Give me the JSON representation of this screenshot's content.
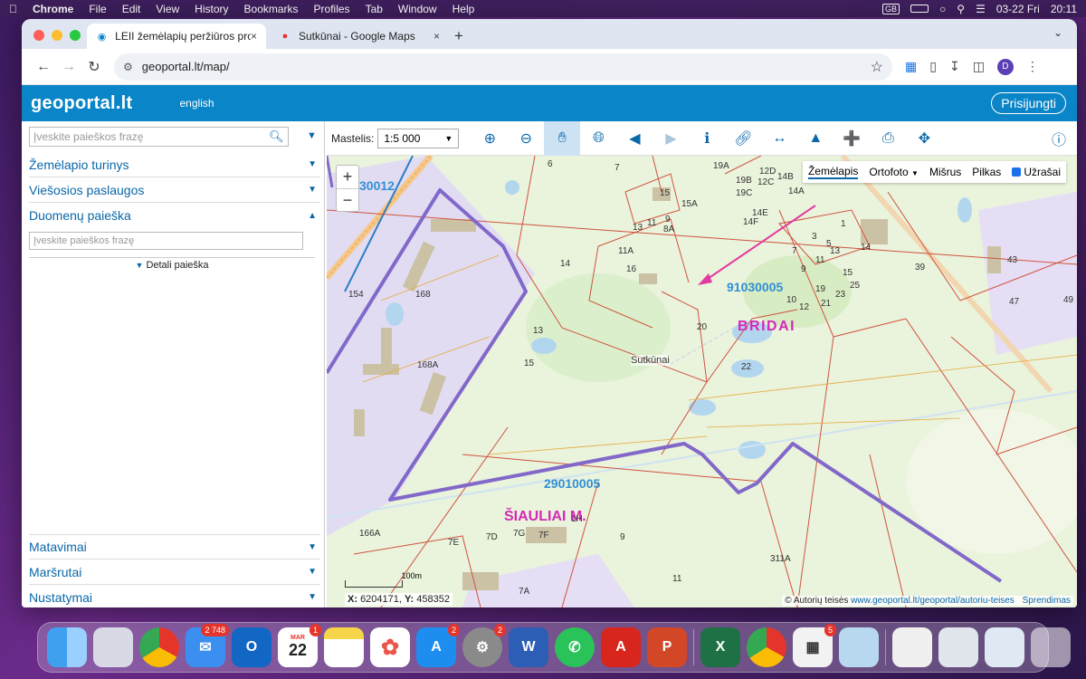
{
  "menubar": {
    "app": "Chrome",
    "items": [
      "File",
      "Edit",
      "View",
      "History",
      "Bookmarks",
      "Profiles",
      "Tab",
      "Window",
      "Help"
    ],
    "date": "03-22 Fri",
    "time": "20:11",
    "input_badge": "GB"
  },
  "browser": {
    "tabs": [
      {
        "title": "LEII žemėlapių peržiūros prog",
        "close": "×"
      },
      {
        "title": "Sutkūnai - Google Maps",
        "close": "×"
      }
    ],
    "new_tab": "+",
    "url": "geoportal.lt/map/",
    "profile_initial": "D"
  },
  "geoportal": {
    "logo": "geoportal.lt",
    "language": "english",
    "login": "Prisijungti"
  },
  "sidebar": {
    "search_placeholder": "Įveskite paieškos frazę",
    "sections": [
      {
        "label": "Žemėlapio turinys"
      },
      {
        "label": "Viešosios paslaugos"
      },
      {
        "label": "Duomenų paieška"
      }
    ],
    "data_search_placeholder": "Įveskite paieškos frazę",
    "detail_search": "Detali paieška",
    "bottom_sections": [
      {
        "label": "Matavimai"
      },
      {
        "label": "Maršrutai"
      },
      {
        "label": "Nustatymai"
      }
    ]
  },
  "map_toolbar": {
    "scale_label": "Mastelis:",
    "scale_value": "1:5 000"
  },
  "layers": {
    "items": [
      "Žemėlapis",
      "Ortofoto",
      "Mišrus",
      "Pilkas"
    ],
    "selected": "Žemėlapis",
    "labels_toggle": "Užrašai"
  },
  "map": {
    "zoom_in": "+",
    "zoom_out": "−",
    "region_codes": [
      "30012",
      "91030005",
      "29010005"
    ],
    "place_names": [
      "BRIDAI",
      "ŠIAULIAI M.",
      "Sutkūnai"
    ],
    "parcels": [
      "6",
      "7",
      "19A",
      "15",
      "15A",
      "11",
      "9",
      "13",
      "8A",
      "11A",
      "16",
      "14",
      "168",
      "168A",
      "154",
      "13",
      "15",
      "20",
      "22",
      "1",
      "3",
      "5",
      "7",
      "13",
      "14",
      "9",
      "11",
      "15",
      "19",
      "23",
      "25",
      "21",
      "10",
      "12",
      "39",
      "43",
      "47",
      "49",
      "166A",
      "7E",
      "7D",
      "7G",
      "7F",
      "9",
      "11",
      "7A",
      "311A",
      "12D",
      "12C",
      "14B",
      "14A",
      "19B",
      "19C",
      "14E",
      "14F",
      "1H"
    ],
    "scale_text": "100m",
    "coords_x_label": "X:",
    "coords_x": "6204171",
    "coords_y_label": "Y:",
    "coords_y": "458352",
    "attribution": "© Autorių teisės",
    "attribution_link": "www.geoportal.lt/geoportal/autoriu-teises",
    "attribution_extra": "Sprendimas"
  },
  "dock": {
    "badges": {
      "mail": "2 748",
      "calendar": "1",
      "appstore": "2",
      "settings": "2",
      "store": "5"
    },
    "calendar_month": "MAR",
    "calendar_day": "22"
  }
}
